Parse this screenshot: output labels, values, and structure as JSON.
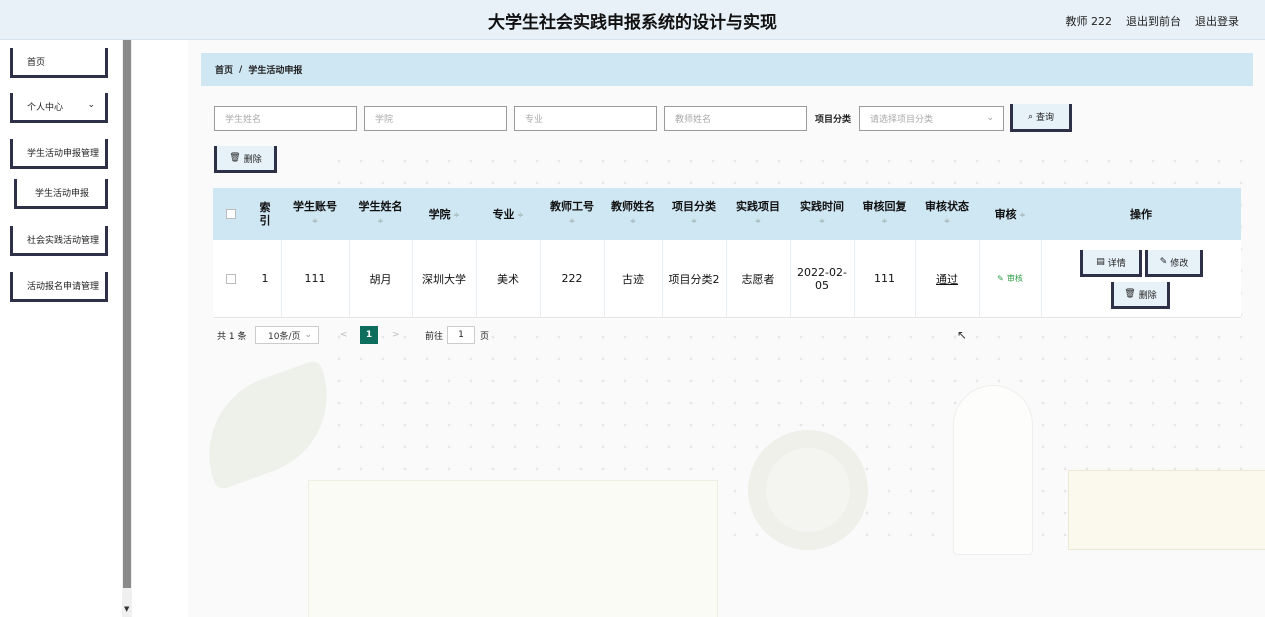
{
  "header": {
    "title": "大学生社会实践申报系统的设计与实现",
    "user": "教师 222",
    "to_front": "退出到前台",
    "logout": "退出登录"
  },
  "sidebar": {
    "items": [
      {
        "label": "首页"
      },
      {
        "label": "个人中心"
      },
      {
        "label": "学生活动申报管理"
      },
      {
        "label": "学生活动申报"
      },
      {
        "label": "社会实践活动管理"
      },
      {
        "label": "活动报名申请管理"
      }
    ]
  },
  "breadcrumb": {
    "home": "首页",
    "sep": "/",
    "current": "学生活动申报"
  },
  "search": {
    "student_name_placeholder": "学生姓名",
    "college_placeholder": "学院",
    "major_placeholder": "专业",
    "teacher_name_placeholder": "教师姓名",
    "category_label": "项目分类",
    "category_placeholder": "请选择项目分类",
    "query_label": "查询"
  },
  "toolbar": {
    "delete_label": "删除"
  },
  "table": {
    "headers": [
      "索引",
      "学生账号",
      "学生姓名",
      "学院",
      "专业",
      "教师工号",
      "教师姓名",
      "项目分类",
      "实践项目",
      "实践时间",
      "审核回复",
      "审核状态",
      "审核",
      "操作"
    ],
    "index_header_line1": "索",
    "index_header_line2": "引",
    "sort_glyph": "≑",
    "rows": [
      {
        "index": "1",
        "student_account": "111",
        "student_name": "胡月",
        "college": "深圳大学",
        "major": "美术",
        "teacher_id": "222",
        "teacher_name": "古迹",
        "category": "项目分类2",
        "project": "志愿者",
        "time_line1": "2022-02-",
        "time_line2": "05",
        "reply": "111",
        "status": "通过",
        "audit_link": "审核",
        "detail_label": "详情",
        "edit_label": "修改",
        "delete_label": "删除"
      }
    ]
  },
  "pagination": {
    "total": "共 1 条",
    "page_size": "10条/页",
    "prev": "<",
    "current_page": "1",
    "next": ">",
    "goto_prefix": "前往",
    "goto_value": "1",
    "goto_suffix": "页"
  }
}
